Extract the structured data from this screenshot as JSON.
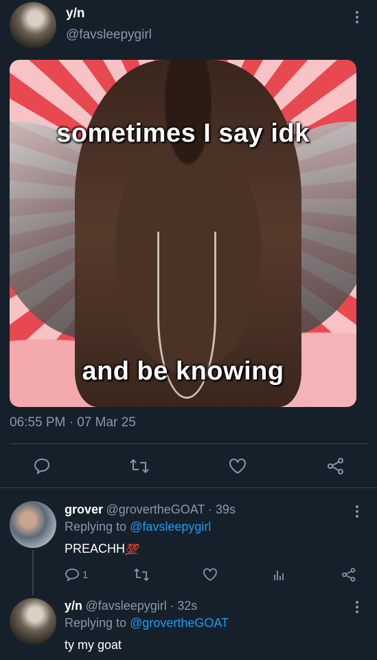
{
  "main_tweet": {
    "name": "y/n",
    "handle": "@favsleepygirl",
    "image": {
      "caption_top": "sometimes I say idk",
      "caption_bottom": "and be knowing"
    },
    "timestamp": "06:55 PM · 07 Mar 25",
    "actions": [
      "reply-icon",
      "retweet-icon",
      "like-icon",
      "share-icon"
    ]
  },
  "replies": [
    {
      "name": "grover",
      "handle": "@grovertheGOAT",
      "time": "· 39s",
      "replying_prefix": "Replying to ",
      "replying_to": "@favsleepygirl",
      "text": "PREACHH",
      "emoji": "💯",
      "reply_count": "1",
      "actions": [
        "reply-icon",
        "retweet-icon",
        "like-icon",
        "stats-icon",
        "share-icon"
      ]
    },
    {
      "name": "y/n",
      "handle": "@favsleepygirl",
      "time": "· 32s",
      "replying_prefix": "Replying to ",
      "replying_to": "@grovertheGOAT",
      "text": "ty my goat"
    }
  ],
  "colors": {
    "background": "#15202b",
    "accent": "#1d9bf0",
    "muted": "#8b98a5",
    "emoji_red": "#e0245e"
  }
}
